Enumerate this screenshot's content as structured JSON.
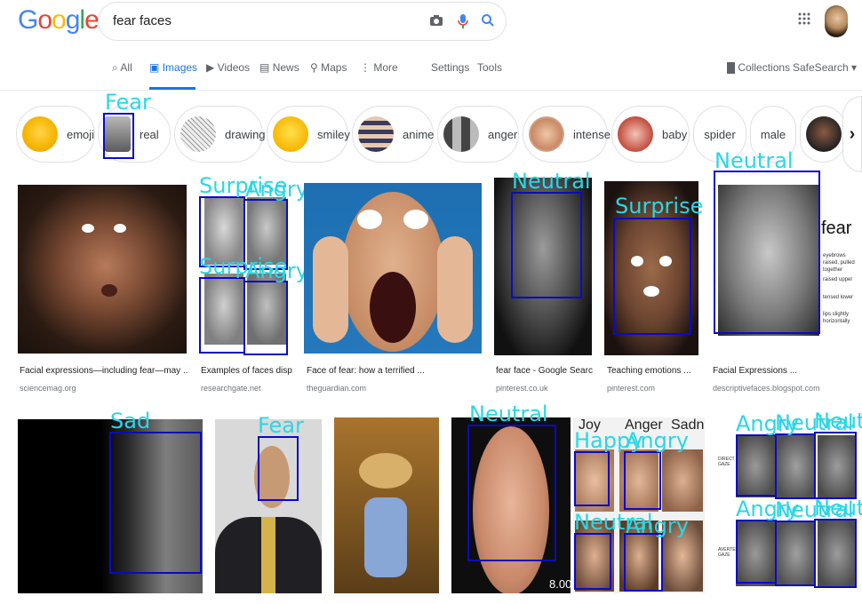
{
  "app": {
    "logo": "Google",
    "query": "fear faces"
  },
  "tabs": [
    {
      "icon": "search-icon",
      "label": "All"
    },
    {
      "icon": "image-icon",
      "label": "Images"
    },
    {
      "icon": "video-icon",
      "label": "Videos"
    },
    {
      "icon": "news-icon",
      "label": "News"
    },
    {
      "icon": "map-pin-icon",
      "label": "Maps"
    },
    {
      "icon": "more-icon",
      "label": "More"
    }
  ],
  "tools": {
    "settings": "Settings",
    "tools": "Tools",
    "collections": "Collections",
    "safesearch": "SafeSearch ▾"
  },
  "chips": [
    "emoji",
    "real",
    "drawing",
    "smiley",
    "anime",
    "anger",
    "intense",
    "baby",
    "spider",
    "male"
  ],
  "results_row1": [
    {
      "caption": "Facial expressions—including fear—may ...",
      "source": "sciencemag.org"
    },
    {
      "caption": "Examples of faces disp...",
      "source": "researchgate.net"
    },
    {
      "caption": "Face of fear: how a terrified ...",
      "source": "theguardian.com"
    },
    {
      "caption": "fear face - Google Searc...",
      "source": "pinterest.co.uk"
    },
    {
      "caption": "Teaching emotions ...",
      "source": "pinterest.com"
    },
    {
      "caption": "Facial Expressions ...",
      "source": "descriptivefaces.blogspot.com"
    }
  ],
  "embedded_text": {
    "fear_word": "fear",
    "diagram_notes": [
      "eyebrows raised, pulled together",
      "raised upper",
      "tensed lower",
      "lips slightly horizontally"
    ],
    "col_headers": [
      "Joy",
      "Anger",
      "Sadne"
    ],
    "gaze_labels": [
      "DIRECT GAZE",
      "AVERTED GAZE"
    ],
    "score": "8.00"
  },
  "detections": {
    "chip_real": "Fear",
    "r1_grid": [
      "Surprise",
      "Angry",
      "Surprise",
      "Angry"
    ],
    "r1_old_man": "Neutral",
    "r1_woman": "Surprise",
    "r1_diagram": "Neutral",
    "r2_hands": "Sad",
    "r2_suit": "Fear",
    "r2_render": "Neutral",
    "r2_joy_grid": [
      "Happy",
      "Angry",
      "Neutral",
      "Angry"
    ],
    "r2_gaze_grid": [
      "Angry",
      "Neutral",
      "Neutral",
      "Angry",
      "Neutral",
      "Neutral"
    ]
  },
  "colors": {
    "accent": "#1a73e8",
    "detect_box": "#0a0ac8",
    "detect_label": "#29d7e6"
  }
}
